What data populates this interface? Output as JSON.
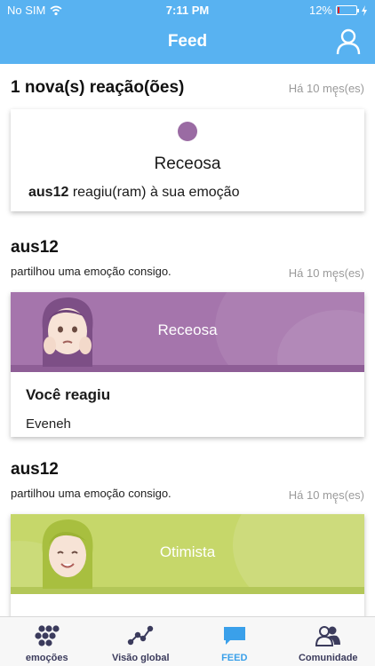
{
  "status_bar": {
    "carrier": "No SIM",
    "time": "7:11 PM",
    "battery_pct": "12%",
    "battery_level": 0.12,
    "battery_color": "#e02020"
  },
  "header": {
    "title": "Feed",
    "bg_color": "#58b2f1",
    "profile_icon": "person-icon"
  },
  "feed": {
    "reactions": {
      "title": "1 nova(s) reação(ões)",
      "time_ago": "Há 10 mę̨s(es)",
      "card": {
        "emotion": "Receosa",
        "dot_color": "#9a6ba3",
        "user": "aus12",
        "text": " reagiu(ram) à sua emoção"
      }
    },
    "posts": [
      {
        "user": "aus12",
        "subtitle": "partilhou uma emoção consigo.",
        "time_ago": "Há 10 mę̨s(es)",
        "emotion": "Receosa",
        "banner_color": "#a575ac",
        "reaction_title": "Você reagiu",
        "reactor": "Eveneh"
      },
      {
        "user": "aus12",
        "subtitle": "partilhou uma emoção consigo.",
        "time_ago": "Há 10 mę̨s(es)",
        "emotion": "Otimista",
        "banner_color": "#c6d76a"
      }
    ]
  },
  "tabbar": {
    "active_color": "#3aa0ea",
    "items": [
      {
        "label": "emoções",
        "icon": "grapes-icon"
      },
      {
        "label": "Visão global",
        "icon": "graph-icon"
      },
      {
        "label": "FEED",
        "icon": "chat-bubble-icon"
      },
      {
        "label": "Comunidade",
        "icon": "people-icon"
      }
    ]
  }
}
